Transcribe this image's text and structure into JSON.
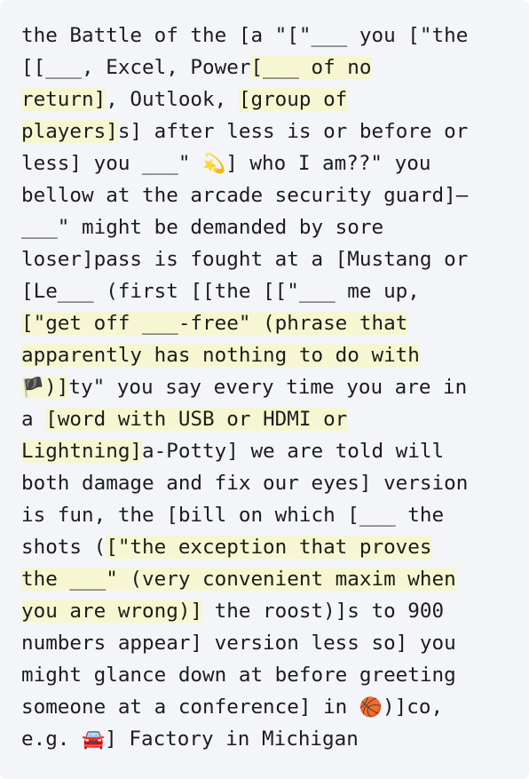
{
  "passage": {
    "lines": [
      [
        {
          "text": "the Battle of the [a \"[\"___ you [\"the"
        }
      ],
      [
        {
          "text": "[[___, Excel, Power"
        },
        {
          "text": "[___ of no",
          "hl": true
        }
      ],
      [
        {
          "text": "return]",
          "hl": true
        },
        {
          "text": ", Outlook, "
        },
        {
          "text": "[group of",
          "hl": true
        }
      ],
      [
        {
          "text": "players]",
          "hl": true
        },
        {
          "text": "s] after less is or before or"
        }
      ],
      [
        {
          "text": "less] you ___\" "
        },
        {
          "text": "💫",
          "emoji": true
        },
        {
          "text": "] who I am??\" you"
        }
      ],
      [
        {
          "text": "bellow at the arcade security guard]–"
        }
      ],
      [
        {
          "text": "___\" might be demanded by sore"
        }
      ],
      [
        {
          "text": "loser]pass is fought at a [Mustang or"
        }
      ],
      [
        {
          "text": "[Le___ (first [[the [[\"___ me up,"
        }
      ],
      [
        {
          "text": "[\"get off ___-free\" (phrase that",
          "hl": true
        }
      ],
      [
        {
          "text": "apparently has nothing to do with",
          "hl": true
        }
      ],
      [
        {
          "text": "🏴",
          "emoji": true,
          "hl": true
        },
        {
          "text": ")]",
          "hl": true
        },
        {
          "text": "ty\" you say every time you are in"
        }
      ],
      [
        {
          "text": "a "
        },
        {
          "text": "[word with USB or HDMI or",
          "hl": true
        }
      ],
      [
        {
          "text": "Lightning]",
          "hl": true
        },
        {
          "text": "a-Potty] we are told will"
        }
      ],
      [
        {
          "text": "both damage and fix our eyes] version"
        }
      ],
      [
        {
          "text": "is fun, the [bill on which [___ the"
        }
      ],
      [
        {
          "text": "shots ("
        },
        {
          "text": "[\"the exception that proves",
          "hl": true
        }
      ],
      [
        {
          "text": "the ___\" (very convenient maxim when",
          "hl": true
        }
      ],
      [
        {
          "text": "you are wrong)]",
          "hl": true
        },
        {
          "text": " the roost)]s to 900"
        }
      ],
      [
        {
          "text": "numbers appear] version less so] you"
        }
      ],
      [
        {
          "text": "might glance down at before greeting"
        }
      ],
      [
        {
          "text": "someone at a conference] in "
        },
        {
          "text": "🏀",
          "emoji": true
        },
        {
          "text": ")]co,"
        }
      ],
      [
        {
          "text": "e.g. "
        },
        {
          "text": "🚘",
          "emoji": true
        },
        {
          "text": "] Factory in Michigan"
        }
      ]
    ]
  },
  "colors": {
    "background": "#f3f5f9",
    "highlight": "#f6f6d2",
    "text": "#1c1c1c"
  }
}
